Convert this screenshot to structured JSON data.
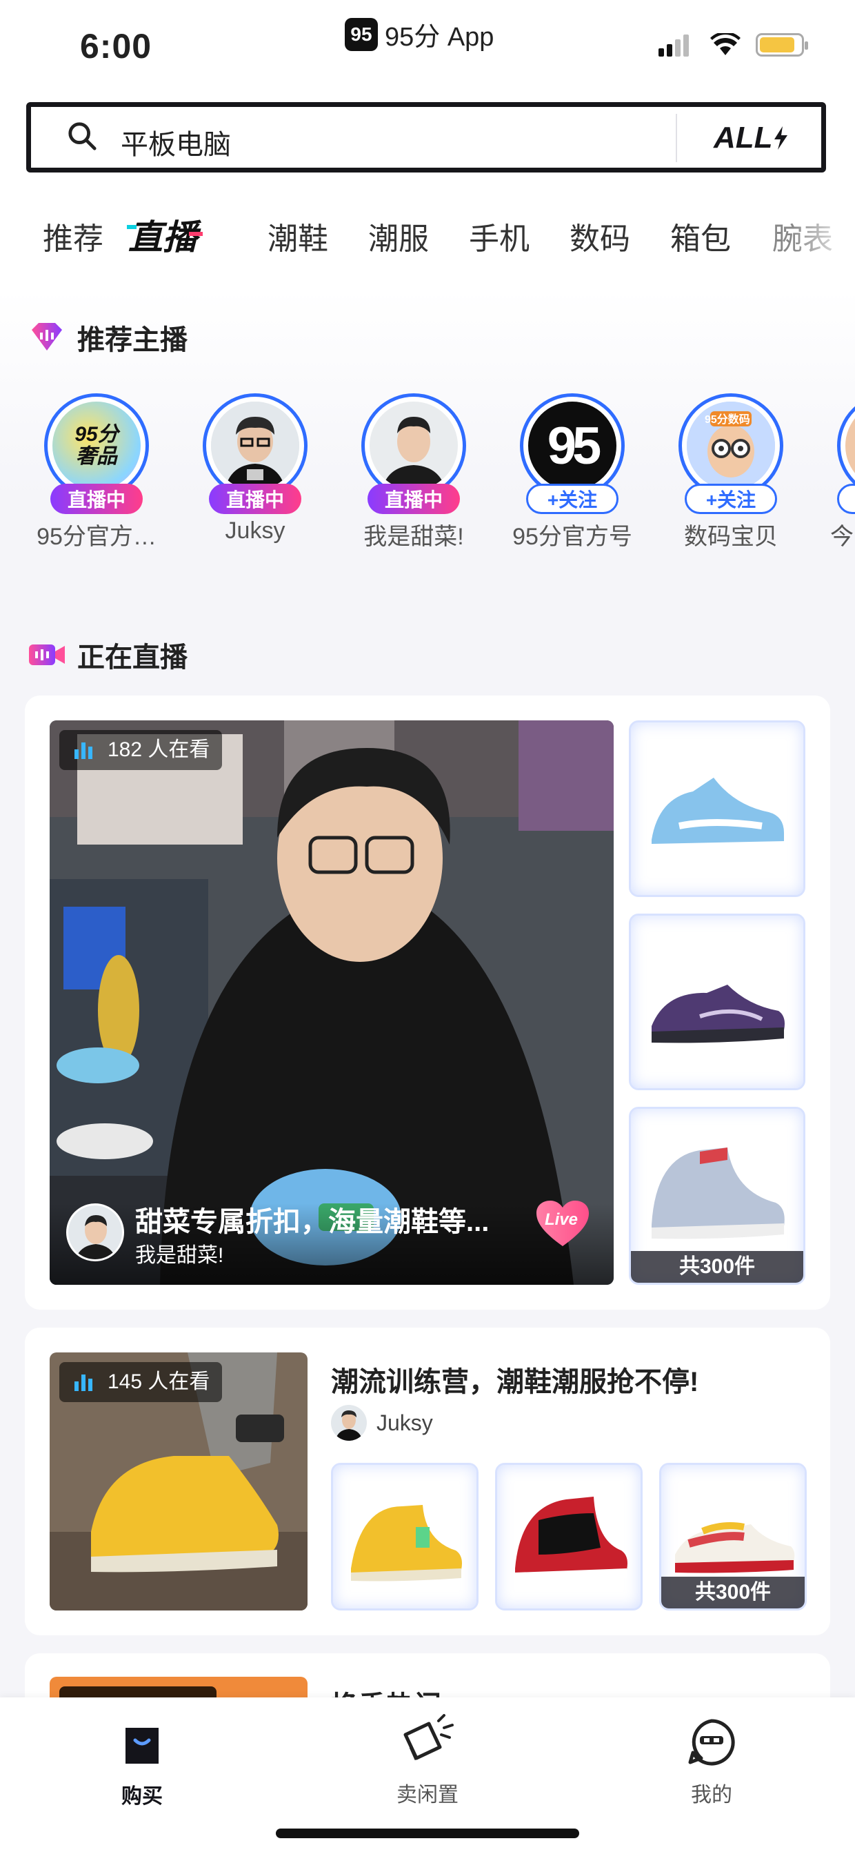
{
  "status_bar": {
    "time": "6:00",
    "app_name": "95分 App",
    "app_logo": "95",
    "battery_color": "#f5c542"
  },
  "search": {
    "query": "平板电脑",
    "all_label": "ALL"
  },
  "tabs": [
    {
      "label": "推荐"
    },
    {
      "label": "直播",
      "active": true
    },
    {
      "label": "潮鞋"
    },
    {
      "label": "潮服"
    },
    {
      "label": "手机"
    },
    {
      "label": "数码"
    },
    {
      "label": "箱包"
    },
    {
      "label": "腕表"
    }
  ],
  "recommended": {
    "title": "推荐主播",
    "anchors": [
      {
        "name": "95分官方…",
        "badge": "直播中",
        "avatar_text": "95分奢品"
      },
      {
        "name": "Juksy",
        "badge": "直播中"
      },
      {
        "name": "我是甜菜!",
        "badge": "直播中"
      },
      {
        "name": "95分官方号",
        "badge": "+关注",
        "avatar_text": "95"
      },
      {
        "name": "数码宝贝",
        "badge": "+关注",
        "avatar_text": "95分数码"
      },
      {
        "name": "今",
        "badge": "+"
      }
    ]
  },
  "live_now": {
    "title": "正在直播",
    "streams": [
      {
        "viewers": "182 人在看",
        "title": "甜菜专属折扣，海量潮鞋等...",
        "host": "我是甜菜!",
        "live_badge": "Live",
        "product_total": "共300件",
        "products": [
          "light-blue-high-top-sneaker",
          "purple-low-sneaker",
          "grey-red-sneaker"
        ]
      },
      {
        "viewers": "145 人在看",
        "title": "潮流训练营，潮鞋潮服抢不停!",
        "host": "Juksy",
        "product_total": "共300件",
        "products": [
          "yellow-boot-sneaker",
          "red-black-high-top",
          "white-red-yellow-dunk"
        ]
      },
      {
        "title": "换季热门…"
      }
    ]
  },
  "tab_bar": {
    "items": [
      {
        "label": "购买",
        "active": true
      },
      {
        "label": "卖闲置"
      },
      {
        "label": "我的"
      }
    ]
  },
  "colors": {
    "accent_blue": "#2f6cff",
    "live_gradient_start": "#8a3cff",
    "live_gradient_end": "#ff3d8b"
  }
}
